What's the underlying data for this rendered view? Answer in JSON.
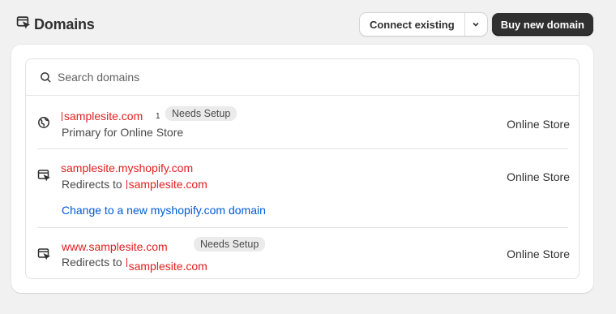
{
  "header": {
    "title": "Domains",
    "connect_label": "Connect existing",
    "buy_label": "Buy new domain"
  },
  "search": {
    "placeholder": "Search domains"
  },
  "domains": [
    {
      "name": "samplesite.com",
      "marker": "1",
      "badge": "Needs Setup",
      "subtitle": "Primary for Online Store",
      "store": "Online Store",
      "icon": "globe-icon"
    },
    {
      "name": "samplesite.myshopify.com",
      "subtitle_prefix": "Redirects to ",
      "subtitle_target": "samplesite.com",
      "link": "Change to a new myshopify.com domain",
      "store": "Online Store",
      "icon": "redirect-icon"
    },
    {
      "name": "www.samplesite.com",
      "badge": "Needs Setup",
      "subtitle_prefix": "Redirects to ",
      "subtitle_target": "samplesite.com",
      "store": "Online Store",
      "icon": "redirect-icon"
    }
  ]
}
